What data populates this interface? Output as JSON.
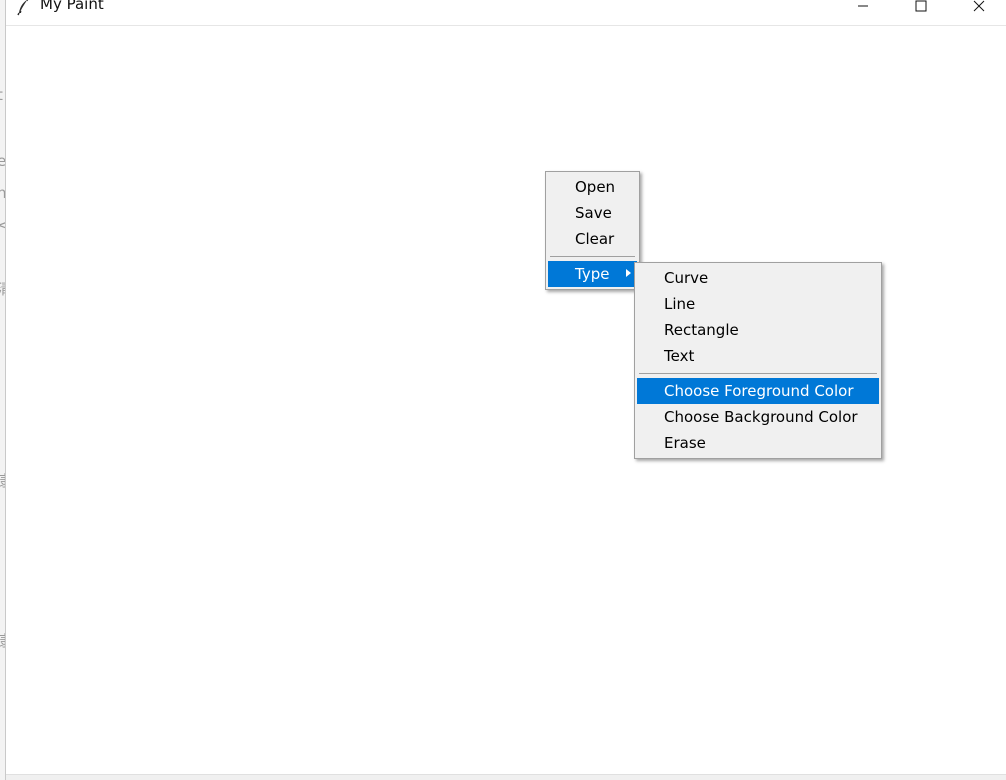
{
  "window": {
    "title": "My Paint",
    "icon": "feather-icon",
    "controls": [
      "minimize-icon",
      "maximize-icon",
      "close-icon"
    ]
  },
  "background_edge_glyphs": [
    "t",
    "e",
    "n",
    "<",
    "清",
    "康",
    "康"
  ],
  "context_menu": {
    "items": [
      {
        "label": "Open"
      },
      {
        "label": "Save"
      },
      {
        "label": "Clear"
      },
      {
        "label": "Type",
        "has_submenu": true,
        "highlighted": true
      }
    ]
  },
  "type_submenu": {
    "items": [
      {
        "label": "Curve"
      },
      {
        "label": "Line"
      },
      {
        "label": "Rectangle"
      },
      {
        "label": "Text"
      }
    ],
    "color_items": [
      {
        "label": "Choose Foreground Color",
        "highlighted": true
      },
      {
        "label": "Choose Background Color"
      },
      {
        "label": "Erase"
      }
    ]
  },
  "colors": {
    "highlight": "#0078d7",
    "menu_background": "#f0f0f0",
    "menu_border": "#a0a0a0",
    "canvas": "#ffffff"
  }
}
